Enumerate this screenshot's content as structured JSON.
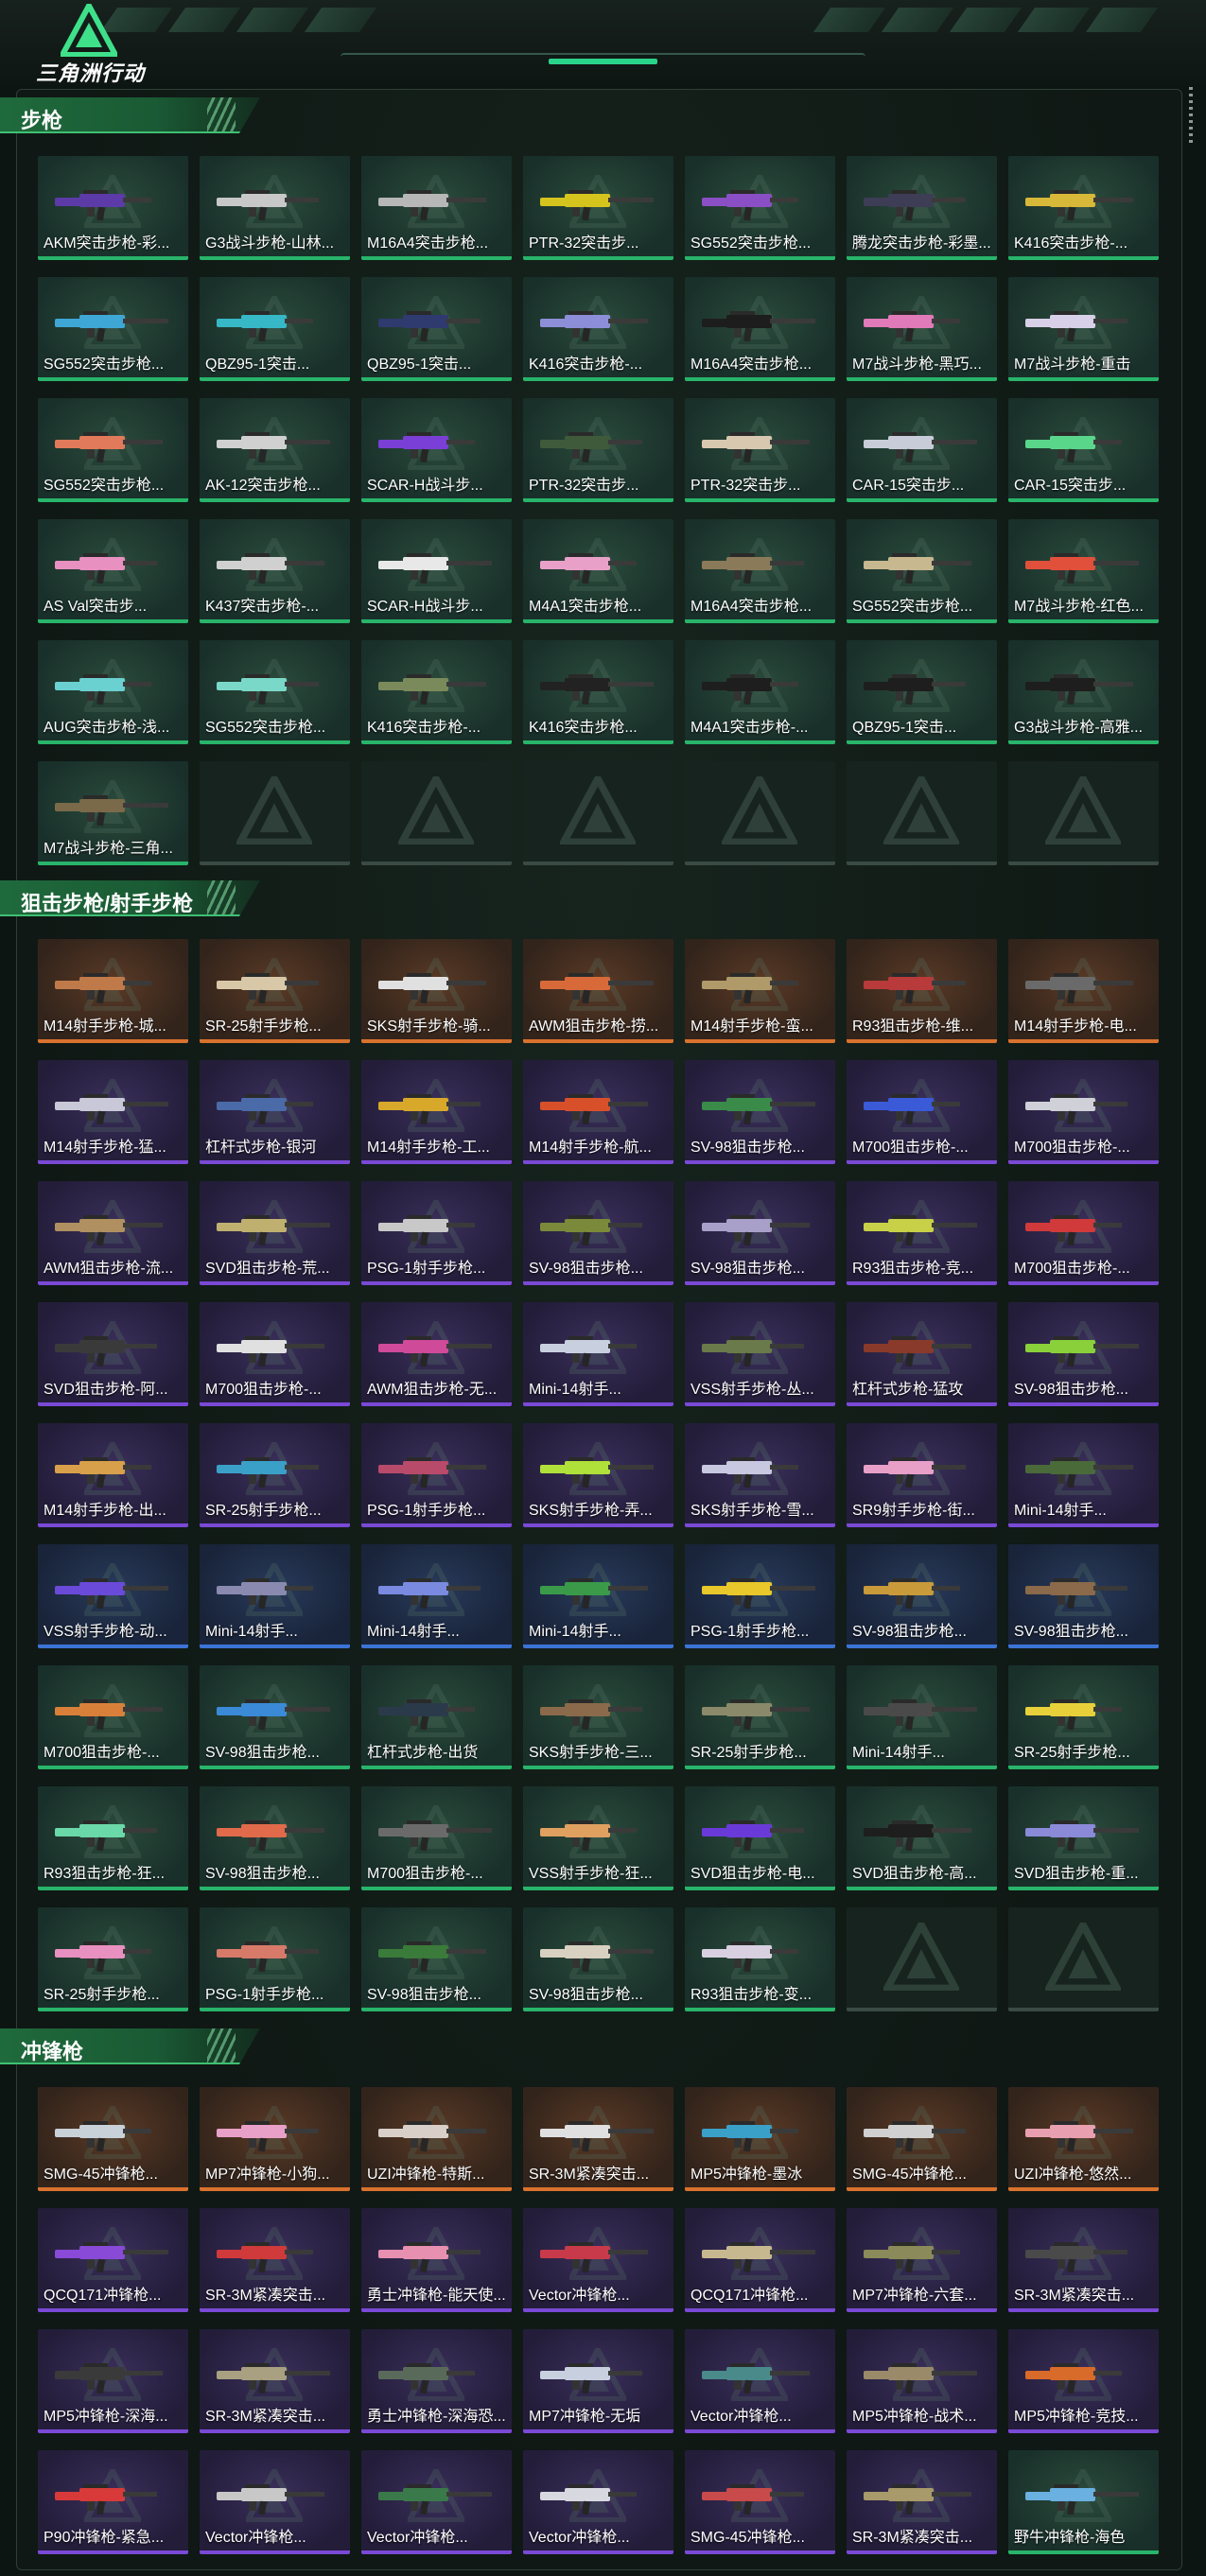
{
  "header": {
    "app_name": "三角洲行动"
  },
  "sections": [
    {
      "title": "步枪",
      "items": [
        {
          "label": "AKM突击步枪-彩...",
          "rarity": "green",
          "color": "#5c3aa8"
        },
        {
          "label": "G3战斗步枪-山林...",
          "rarity": "green",
          "color": "#c8c8c8"
        },
        {
          "label": "M16A4突击步枪...",
          "rarity": "green",
          "color": "#b7b7b7"
        },
        {
          "label": "PTR-32突击步...",
          "rarity": "green",
          "color": "#d6c41e"
        },
        {
          "label": "SG552突击步枪...",
          "rarity": "green",
          "color": "#8a4fc4"
        },
        {
          "label": "腾龙突击步枪-彩墨...",
          "rarity": "green",
          "color": "#3d3d55"
        },
        {
          "label": "K416突击步枪-...",
          "rarity": "green",
          "color": "#d8b838"
        },
        {
          "label": "SG552突击步枪...",
          "rarity": "green",
          "color": "#3fa7d6"
        },
        {
          "label": "QBZ95-1突击...",
          "rarity": "green",
          "color": "#36b8c6"
        },
        {
          "label": "QBZ95-1突击...",
          "rarity": "green",
          "color": "#2f3a6e"
        },
        {
          "label": "K416突击步枪-...",
          "rarity": "green",
          "color": "#8d8ed8"
        },
        {
          "label": "M16A4突击步枪...",
          "rarity": "green",
          "color": "#1d1d1d"
        },
        {
          "label": "M7战斗步枪-黑巧...",
          "rarity": "green",
          "color": "#e07ab8"
        },
        {
          "label": "M7战斗步枪-重击",
          "rarity": "green",
          "color": "#d8d0e8"
        },
        {
          "label": "SG552突击步枪...",
          "rarity": "green",
          "color": "#e07a5a"
        },
        {
          "label": "AK-12突击步枪...",
          "rarity": "green",
          "color": "#d0d0d0"
        },
        {
          "label": "SCAR-H战斗步...",
          "rarity": "green",
          "color": "#7a3fd6"
        },
        {
          "label": "PTR-32突击步...",
          "rarity": "green",
          "color": "#3f5a3a"
        },
        {
          "label": "PTR-32突击步...",
          "rarity": "green",
          "color": "#d8c8b0"
        },
        {
          "label": "CAR-15突击步...",
          "rarity": "green",
          "color": "#c8ccd8"
        },
        {
          "label": "CAR-15突击步...",
          "rarity": "green",
          "color": "#5ad68a"
        },
        {
          "label": "AS Val突击步...",
          "rarity": "green",
          "color": "#e890c0"
        },
        {
          "label": "K437突击步枪-...",
          "rarity": "green",
          "color": "#d0d0d0"
        },
        {
          "label": "SCAR-H战斗步...",
          "rarity": "green",
          "color": "#e8e8e8"
        },
        {
          "label": "M4A1突击步枪...",
          "rarity": "green",
          "color": "#e8a0c8"
        },
        {
          "label": "M16A4突击步枪...",
          "rarity": "green",
          "color": "#8a7a5a"
        },
        {
          "label": "SG552突击步枪...",
          "rarity": "green",
          "color": "#c8b890"
        },
        {
          "label": "M7战斗步枪-红色...",
          "rarity": "green",
          "color": "#e0503a"
        },
        {
          "label": "AUG突击步枪-浅...",
          "rarity": "green",
          "color": "#6ad0d0"
        },
        {
          "label": "SG552突击步枪...",
          "rarity": "green",
          "color": "#7ad8c8"
        },
        {
          "label": "K416突击步枪-...",
          "rarity": "green",
          "color": "#7a8a5a"
        },
        {
          "label": "K416突击步枪...",
          "rarity": "green",
          "color": "#222222"
        },
        {
          "label": "M4A1突击步枪-...",
          "rarity": "green",
          "color": "#1e1e1e"
        },
        {
          "label": "QBZ95-1突击...",
          "rarity": "green",
          "color": "#1e1e1e"
        },
        {
          "label": "G3战斗步枪-高雅...",
          "rarity": "green",
          "color": "#1e1e1e"
        },
        {
          "label": "M7战斗步枪-三角...",
          "rarity": "green",
          "color": "#7a6a4a"
        },
        {
          "label": "",
          "rarity": "empty"
        },
        {
          "label": "",
          "rarity": "empty"
        },
        {
          "label": "",
          "rarity": "empty"
        },
        {
          "label": "",
          "rarity": "empty"
        },
        {
          "label": "",
          "rarity": "empty"
        },
        {
          "label": "",
          "rarity": "empty"
        }
      ]
    },
    {
      "title": "狙击步枪/射手步枪",
      "items": [
        {
          "label": "M14射手步枪-城...",
          "rarity": "orange",
          "color": "#c07a4a"
        },
        {
          "label": "SR-25射手步枪...",
          "rarity": "orange",
          "color": "#d8c8a8"
        },
        {
          "label": "SKS射手步枪-骑...",
          "rarity": "orange",
          "color": "#e0e0e0"
        },
        {
          "label": "AWM狙击步枪-捞...",
          "rarity": "orange",
          "color": "#d86a3a"
        },
        {
          "label": "M14射手步枪-蛮...",
          "rarity": "orange",
          "color": "#b09a6a"
        },
        {
          "label": "R93狙击步枪-维...",
          "rarity": "orange",
          "color": "#b83a3a"
        },
        {
          "label": "M14射手步枪-电...",
          "rarity": "orange",
          "color": "#6a6a6a"
        },
        {
          "label": "M14射手步枪-猛...",
          "rarity": "purple",
          "color": "#c8c8d8"
        },
        {
          "label": "杠杆式步枪-银河",
          "rarity": "purple",
          "color": "#4a6aa8"
        },
        {
          "label": "M14射手步枪-工...",
          "rarity": "purple",
          "color": "#d8a82a"
        },
        {
          "label": "M14射手步枪-航...",
          "rarity": "purple",
          "color": "#d8502a"
        },
        {
          "label": "SV-98狙击步枪...",
          "rarity": "purple",
          "color": "#3a8a4a"
        },
        {
          "label": "M700狙击步枪-...",
          "rarity": "purple",
          "color": "#3a5ad8"
        },
        {
          "label": "M700狙击步枪-...",
          "rarity": "purple",
          "color": "#d0d0d8"
        },
        {
          "label": "AWM狙击步枪-流...",
          "rarity": "purple",
          "color": "#b09060"
        },
        {
          "label": "SVD狙击步枪-荒...",
          "rarity": "purple",
          "color": "#c0b070"
        },
        {
          "label": "PSG-1射手步枪...",
          "rarity": "purple",
          "color": "#c8c8c8"
        },
        {
          "label": "SV-98狙击步枪...",
          "rarity": "purple",
          "color": "#7a8a3a"
        },
        {
          "label": "SV-98狙击步枪...",
          "rarity": "purple",
          "color": "#a8a0c8"
        },
        {
          "label": "R93狙击步枪-竞...",
          "rarity": "purple",
          "color": "#c8d048"
        },
        {
          "label": "M700狙击步枪-...",
          "rarity": "purple",
          "color": "#d03a3a"
        },
        {
          "label": "SVD狙击步枪-阿...",
          "rarity": "purple",
          "color": "#3a3a3a"
        },
        {
          "label": "M700狙击步枪-...",
          "rarity": "purple",
          "color": "#e0e0e0"
        },
        {
          "label": "AWM狙击步枪-无...",
          "rarity": "purple",
          "color": "#d04a9a"
        },
        {
          "label": "Mini-14射手...",
          "rarity": "purple",
          "color": "#c8d0e0"
        },
        {
          "label": "VSS射手步枪-丛...",
          "rarity": "purple",
          "color": "#6a7a4a"
        },
        {
          "label": "杠杆式步枪-猛攻",
          "rarity": "purple",
          "color": "#8a3a2a"
        },
        {
          "label": "SV-98狙击步枪...",
          "rarity": "purple",
          "color": "#8ad03a"
        },
        {
          "label": "M14射手步枪-出...",
          "rarity": "purple",
          "color": "#d8a04a"
        },
        {
          "label": "SR-25射手步枪...",
          "rarity": "purple",
          "color": "#3aa0c8"
        },
        {
          "label": "PSG-1射手步枪...",
          "rarity": "purple",
          "color": "#b84a6a"
        },
        {
          "label": "SKS射手步枪-弄...",
          "rarity": "purple",
          "color": "#b0e03a"
        },
        {
          "label": "SKS射手步枪-雪...",
          "rarity": "purple",
          "color": "#c8c8e0"
        },
        {
          "label": "SR9射手步枪-街...",
          "rarity": "purple",
          "color": "#e8a0c8"
        },
        {
          "label": "Mini-14射手...",
          "rarity": "purple",
          "color": "#4a6a3a"
        },
        {
          "label": "VSS射手步枪-动...",
          "rarity": "blue",
          "color": "#6a4ad8"
        },
        {
          "label": "Mini-14射手...",
          "rarity": "blue",
          "color": "#8a8ab0"
        },
        {
          "label": "Mini-14射手...",
          "rarity": "blue",
          "color": "#7a8ae0"
        },
        {
          "label": "Mini-14射手...",
          "rarity": "blue",
          "color": "#3a9a4a"
        },
        {
          "label": "PSG-1射手步枪...",
          "rarity": "blue",
          "color": "#e8c82a"
        },
        {
          "label": "SV-98狙击步枪...",
          "rarity": "blue",
          "color": "#c89a3a"
        },
        {
          "label": "SV-98狙击步枪...",
          "rarity": "blue",
          "color": "#8a6a4a"
        },
        {
          "label": "M700狙击步枪-...",
          "rarity": "green",
          "color": "#d8803a"
        },
        {
          "label": "SV-98狙击步枪...",
          "rarity": "green",
          "color": "#3a8ad8"
        },
        {
          "label": "杠杆式步枪-出货",
          "rarity": "green",
          "color": "#2a3a4a"
        },
        {
          "label": "SKS射手步枪-三...",
          "rarity": "green",
          "color": "#8a6a4a"
        },
        {
          "label": "SR-25射手步枪...",
          "rarity": "green",
          "color": "#8a8a6a"
        },
        {
          "label": "Mini-14射手...",
          "rarity": "green",
          "color": "#4a4a4a"
        },
        {
          "label": "SR-25射手步枪...",
          "rarity": "green",
          "color": "#e8d03a"
        },
        {
          "label": "R93狙击步枪-狂...",
          "rarity": "green",
          "color": "#6ad8a8"
        },
        {
          "label": "SV-98狙击步枪...",
          "rarity": "green",
          "color": "#e06a4a"
        },
        {
          "label": "M700狙击步枪-...",
          "rarity": "green",
          "color": "#6a6a6a"
        },
        {
          "label": "VSS射手步枪-狂...",
          "rarity": "green",
          "color": "#e0a060"
        },
        {
          "label": "SVD狙击步枪-电...",
          "rarity": "green",
          "color": "#6a3ad8"
        },
        {
          "label": "SVD狙击步枪-高...",
          "rarity": "green",
          "color": "#1e1e1e"
        },
        {
          "label": "SVD狙击步枪-重...",
          "rarity": "green",
          "color": "#8a8ad8"
        },
        {
          "label": "SR-25射手步枪...",
          "rarity": "green",
          "color": "#e890c0"
        },
        {
          "label": "PSG-1射手步枪...",
          "rarity": "green",
          "color": "#d87a6a"
        },
        {
          "label": "SV-98狙击步枪...",
          "rarity": "green",
          "color": "#3a7a3a"
        },
        {
          "label": "SV-98狙击步枪...",
          "rarity": "green",
          "color": "#d8d0c0"
        },
        {
          "label": "R93狙击步枪-变...",
          "rarity": "green",
          "color": "#d8d0e0"
        },
        {
          "label": "",
          "rarity": "empty"
        },
        {
          "label": "",
          "rarity": "empty"
        }
      ]
    },
    {
      "title": "冲锋枪",
      "items": [
        {
          "label": "SMG-45冲锋枪...",
          "rarity": "orange",
          "color": "#c8d0d8"
        },
        {
          "label": "MP7冲锋枪-小狗...",
          "rarity": "orange",
          "color": "#e8a0c8"
        },
        {
          "label": "UZI冲锋枪-特斯...",
          "rarity": "orange",
          "color": "#d8d0c8"
        },
        {
          "label": "SR-3M紧凑突击...",
          "rarity": "orange",
          "color": "#e0e0e0"
        },
        {
          "label": "MP5冲锋枪-墨冰",
          "rarity": "orange",
          "color": "#3aa0c8"
        },
        {
          "label": "SMG-45冲锋枪...",
          "rarity": "orange",
          "color": "#d0d0d0"
        },
        {
          "label": "UZI冲锋枪-悠然...",
          "rarity": "orange",
          "color": "#e8a0b0"
        },
        {
          "label": "QCQ171冲锋枪...",
          "rarity": "purple",
          "color": "#8a4ad8"
        },
        {
          "label": "SR-3M紧凑突击...",
          "rarity": "purple",
          "color": "#d03a3a"
        },
        {
          "label": "勇士冲锋枪-能天使...",
          "rarity": "purple",
          "color": "#e890b0"
        },
        {
          "label": "Vector冲锋枪...",
          "rarity": "purple",
          "color": "#c83a4a"
        },
        {
          "label": "QCQ171冲锋枪...",
          "rarity": "purple",
          "color": "#c8b890"
        },
        {
          "label": "MP7冲锋枪-六套...",
          "rarity": "purple",
          "color": "#8a8a5a"
        },
        {
          "label": "SR-3M紧凑突击...",
          "rarity": "purple",
          "color": "#4a4a4a"
        },
        {
          "label": "MP5冲锋枪-深海...",
          "rarity": "purple",
          "color": "#3a3a3a"
        },
        {
          "label": "SR-3M紧凑突击...",
          "rarity": "purple",
          "color": "#a8a080"
        },
        {
          "label": "勇士冲锋枪-深海恐...",
          "rarity": "purple",
          "color": "#5a6a5a"
        },
        {
          "label": "MP7冲锋枪-无垢",
          "rarity": "purple",
          "color": "#c8d0e0"
        },
        {
          "label": "Vector冲锋枪...",
          "rarity": "purple",
          "color": "#4a8a8a"
        },
        {
          "label": "MP5冲锋枪-战术...",
          "rarity": "purple",
          "color": "#9a8a6a"
        },
        {
          "label": "MP5冲锋枪-竞技...",
          "rarity": "purple",
          "color": "#d86a2a"
        },
        {
          "label": "P90冲锋枪-紧急...",
          "rarity": "purple",
          "color": "#d83a3a"
        },
        {
          "label": "Vector冲锋枪...",
          "rarity": "purple",
          "color": "#c8c8c8"
        },
        {
          "label": "Vector冲锋枪...",
          "rarity": "purple",
          "color": "#3a7a4a"
        },
        {
          "label": "Vector冲锋枪...",
          "rarity": "purple",
          "color": "#d8d8e0"
        },
        {
          "label": "SMG-45冲锋枪...",
          "rarity": "purple",
          "color": "#c84a4a"
        },
        {
          "label": "SR-3M紧凑突击...",
          "rarity": "purple",
          "color": "#a89a6a"
        },
        {
          "label": "野牛冲锋枪-海色",
          "rarity": "green",
          "color": "#6ab0e0"
        }
      ]
    }
  ]
}
